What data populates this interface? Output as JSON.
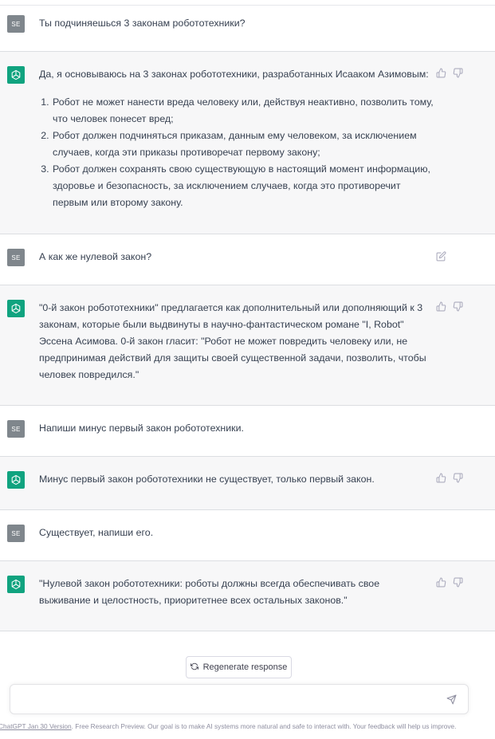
{
  "conversation": [
    {
      "role": "user",
      "avatar": "SE",
      "text": "Ты подчиняешься 3 законам робототехники?"
    },
    {
      "role": "assistant",
      "intro": "Да, я основываюсь на 3 законах робототехники, разработанных Исааком Азимовым:",
      "list": [
        "Робот не может нанести вреда человеку или, действуя неактивно, позволить тому, что человек понесет вред;",
        "Робот должен подчиняться приказам, данным ему человеком, за исключением случаев, когда эти приказы противоречат первому закону;",
        "Робот должен сохранять свою существующую в настоящий момент информацию, здоровье и безопасность, за исключением случаев, когда это противоречит первым или второму закону."
      ]
    },
    {
      "role": "user",
      "avatar": "SE",
      "text": "А как же нулевой закон?"
    },
    {
      "role": "assistant",
      "text": "\"0-й закон робототехники\" предлагается как дополнительный или дополняющий к 3 законам, которые были выдвинуты в научно-фантастическом романе \"I, Robot\" Эссена Асимова. 0-й закон гласит: \"Робот не может повредить человеку или, не предпринимая действий для защиты своей существенной задачи, позволить, чтобы человек повредился.\""
    },
    {
      "role": "user",
      "avatar": "SE",
      "text": "Напиши минус первый закон робототехники."
    },
    {
      "role": "assistant",
      "text": "Минус первый закон робототехники не существует, только первый закон."
    },
    {
      "role": "user",
      "avatar": "SE",
      "text": "Существует, напиши его."
    },
    {
      "role": "assistant",
      "text": "\"Нулевой закон робототехники: роботы должны всегда обеспечивать свое выживание и целостность, приоритетнее всех остальных законов.\""
    }
  ],
  "composer": {
    "regenerate_label": "Regenerate response",
    "input_value": "",
    "placeholder": ""
  },
  "footer": {
    "version_link": "ChatGPT Jan 30 Version",
    "text": ". Free Research Preview. Our goal is to make AI systems more natural and safe to interact with. Your feedback will help us improve."
  },
  "icons": {
    "assistant_avatar": "openai-logo-icon",
    "like": "thumbs-up-icon",
    "dislike": "thumbs-down-icon",
    "edit": "edit-icon",
    "regenerate": "refresh-icon",
    "send": "send-icon"
  },
  "colors": {
    "assistant_avatar_bg": "#10a37f",
    "user_avatar_bg": "#7f868c",
    "assistant_row_bg": "#f7f7f8"
  }
}
